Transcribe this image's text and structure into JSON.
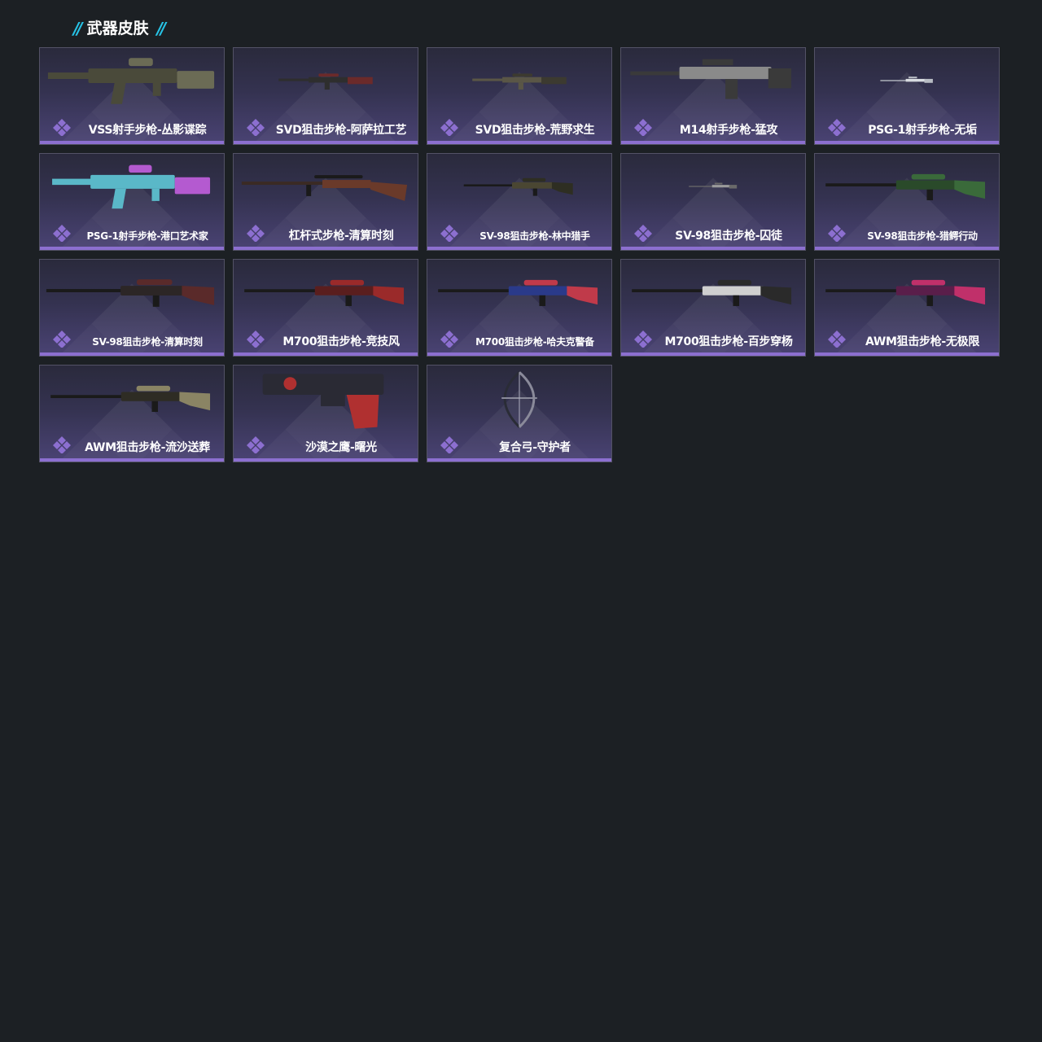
{
  "section": {
    "title": "武器皮肤",
    "mark": "//"
  },
  "colors": {
    "background": "#1c2024",
    "accent_cyan": "#27c3e6",
    "rarity_purple": "#8c6fd0",
    "card_border": "#535266"
  },
  "cards": [
    {
      "name": "VSS射手步枪-丛影谍踪",
      "icon": "vss-rifle-icon"
    },
    {
      "name": "SVD狙击步枪-阿萨拉工艺",
      "icon": "svd-rifle-icon"
    },
    {
      "name": "SVD狙击步枪-荒野求生",
      "icon": "svd-rifle-icon"
    },
    {
      "name": "M14射手步枪-猛攻",
      "icon": "m14-rifle-icon"
    },
    {
      "name": "PSG-1射手步枪-无垢",
      "icon": "psg1-rifle-icon"
    },
    {
      "name": "PSG-1射手步枪-港口艺术家",
      "icon": "psg1-rifle-icon"
    },
    {
      "name": "杠杆式步枪-清算时刻",
      "icon": "lever-rifle-icon"
    },
    {
      "name": "SV-98狙击步枪-林中猎手",
      "icon": "sv98-rifle-icon"
    },
    {
      "name": "SV-98狙击步枪-囚徒",
      "icon": "sv98-rifle-icon"
    },
    {
      "name": "SV-98狙击步枪-猎鳄行动",
      "icon": "sv98-rifle-icon"
    },
    {
      "name": "SV-98狙击步枪-清算时刻",
      "icon": "sv98-rifle-icon"
    },
    {
      "name": "M700狙击步枪-竞技风",
      "icon": "m700-rifle-icon"
    },
    {
      "name": "M700狙击步枪-哈夫克警备",
      "icon": "m700-rifle-icon"
    },
    {
      "name": "M700狙击步枪-百步穿杨",
      "icon": "m700-rifle-icon"
    },
    {
      "name": "AWM狙击步枪-无极限",
      "icon": "awm-rifle-icon"
    },
    {
      "name": "AWM狙击步枪-流沙送葬",
      "icon": "awm-rifle-icon"
    },
    {
      "name": "沙漠之鹰-曙光",
      "icon": "desert-eagle-pistol-icon"
    },
    {
      "name": "复合弓-守护者",
      "icon": "compound-bow-icon"
    }
  ]
}
